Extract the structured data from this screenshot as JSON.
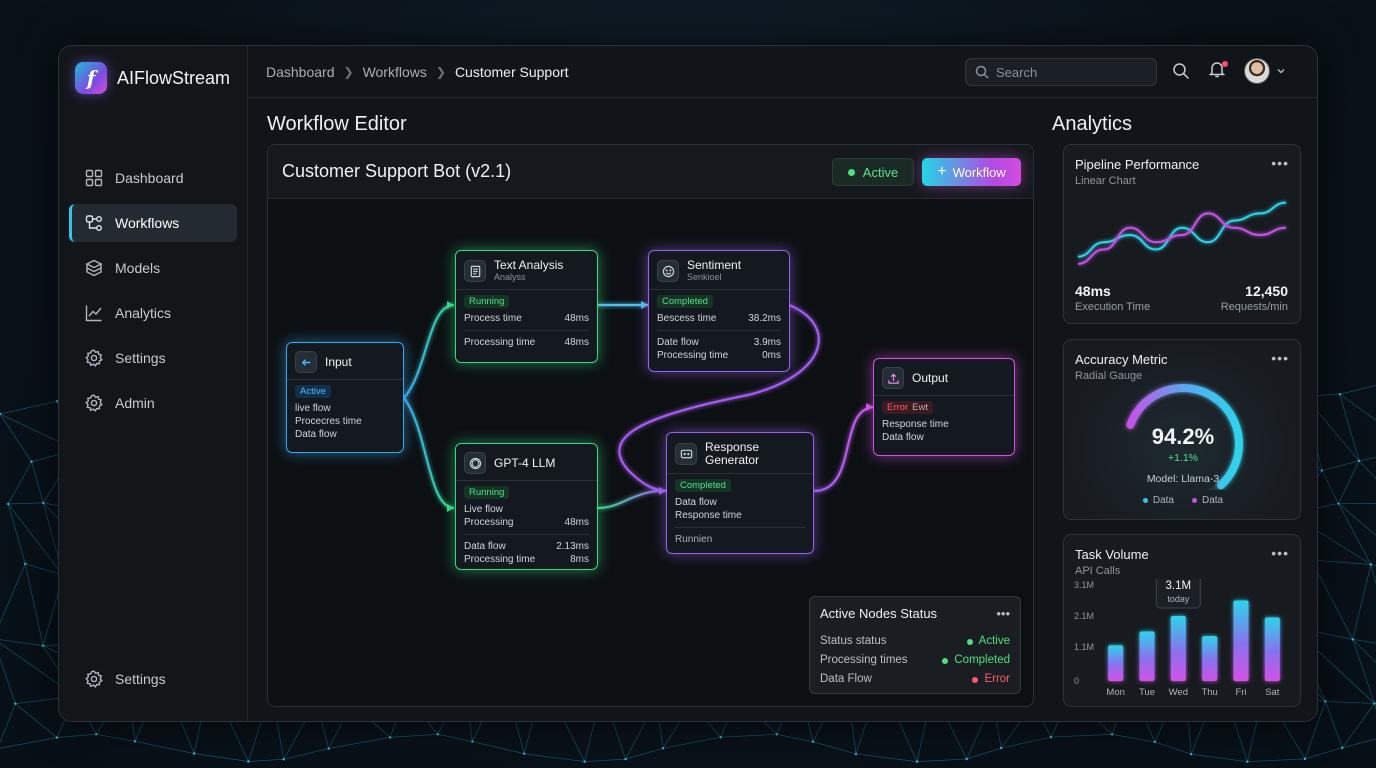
{
  "app": {
    "brand_letter": "f",
    "name": "AIFlowStream"
  },
  "nav": {
    "items": [
      {
        "label": "Dashboard",
        "icon": "grid-icon",
        "active": false
      },
      {
        "label": "Workflows",
        "icon": "workflow-icon",
        "active": true
      },
      {
        "label": "Models",
        "icon": "cube-icon",
        "active": false
      },
      {
        "label": "Analytics",
        "icon": "chart-icon",
        "active": false
      },
      {
        "label": "Settings",
        "icon": "gear-icon",
        "active": false
      },
      {
        "label": "Admin",
        "icon": "gear-icon",
        "active": false
      }
    ],
    "bottom_label": "Settings"
  },
  "breadcrumb": [
    "Dashboard",
    "Workflows",
    "Customer Support"
  ],
  "search": {
    "placeholder": "Search"
  },
  "editor": {
    "section_title": "Workflow Editor",
    "title": "Customer Support Bot (v2.1)",
    "active_label": "Active",
    "workflow_button": "Workflow"
  },
  "nodes": {
    "input": {
      "title": "Input",
      "badge": "Active",
      "lines": [
        "live flow",
        "Procecres time",
        "Data flow"
      ]
    },
    "text_analysis": {
      "title": "Text Analysis",
      "subtitle": "Analyss",
      "badge": "Running",
      "rows": [
        {
          "label": "Process time",
          "value": "48ms"
        },
        {
          "label": "Processing time",
          "value": "48ms"
        }
      ]
    },
    "sentiment": {
      "title": "Sentiment",
      "subtitle": "Senkioel",
      "badge": "Completed",
      "rows": [
        {
          "label": "Bescess time",
          "value": "38.2ms"
        },
        {
          "label": "Date flow",
          "value": "3.9ms"
        },
        {
          "label": "Processing time",
          "value": "0ms"
        }
      ]
    },
    "gpt": {
      "title": "GPT-4 LLM",
      "badge": "Running",
      "rows": [
        {
          "label": "Live flow",
          "value": ""
        },
        {
          "label": "Processing",
          "value": "48ms"
        },
        {
          "label": "Data flow",
          "value": "2.13ms"
        },
        {
          "label": "Processing time",
          "value": "8ms"
        }
      ]
    },
    "response": {
      "title_line1": "Response",
      "title_line2": "Generator",
      "badge": "Completed",
      "lines": [
        "Data flow",
        "Response time"
      ],
      "footer": "Runnien"
    },
    "output": {
      "title": "Output",
      "badge": "Error",
      "badge_extra": "Ewt",
      "lines": [
        "Response time",
        "Data flow"
      ]
    }
  },
  "status_panel": {
    "title": "Active Nodes Status",
    "rows": [
      {
        "label": "Status status",
        "value": "Active",
        "color": "#4ee07f"
      },
      {
        "label": "Processing times",
        "value": "Completed",
        "color": "#4ee07f"
      },
      {
        "label": "Data Flow",
        "value": "Error",
        "color": "#ff5a6e"
      }
    ]
  },
  "analytics": {
    "section_title": "Analytics",
    "performance": {
      "title": "Pipeline Performance",
      "subtitle": "Linear Chart",
      "metric1_value": "48ms",
      "metric1_label": "Execution Time",
      "metric2_value": "12,450",
      "metric2_label": "Requests/min"
    },
    "accuracy": {
      "title": "Accuracy Metric",
      "subtitle": "Radial Gauge",
      "value": "94.2%",
      "percent": 94.2,
      "delta": "+1.1%",
      "model": "Model: Llama-3",
      "legend": [
        {
          "label": "Data",
          "color": "#2fc7e6"
        },
        {
          "label": "Data",
          "color": "#c453e6"
        }
      ]
    },
    "volume": {
      "title": "Task Volume",
      "subtitle": "API Calls",
      "tooltip_value": "3.1M",
      "tooltip_label": "today"
    }
  },
  "colors": {
    "cyan": "#2fd3ea",
    "purple": "#9b61f0",
    "magenta": "#d352e6",
    "green": "#35d886",
    "blue": "#38a7ee"
  },
  "chart_data": [
    {
      "type": "line",
      "title": "Pipeline Performance",
      "x": [
        0,
        1,
        2,
        3,
        4,
        5,
        6,
        7,
        8
      ],
      "series": [
        {
          "values": [
            2,
            4,
            5,
            3,
            6,
            4,
            7,
            8,
            9.5
          ],
          "color": "#2fd3ea"
        },
        {
          "values": [
            1,
            3,
            6,
            4,
            5,
            8,
            6,
            5,
            6
          ],
          "color": "#c453e6"
        }
      ],
      "ylim": [
        0,
        10
      ]
    },
    {
      "type": "bar",
      "title": "Task Volume",
      "categories": [
        "Mon",
        "Tue",
        "Wed",
        "Thu",
        "Fri",
        "Sat"
      ],
      "values": [
        1.15,
        1.6,
        2.1,
        1.45,
        2.6,
        2.05
      ],
      "yticks": [
        "0",
        "1.1M",
        "2.1M",
        "3.1M"
      ],
      "ytick_values": [
        0,
        1.1,
        2.1,
        3.1
      ],
      "ylim": [
        0,
        3.1
      ],
      "highlight_index": 2
    }
  ]
}
